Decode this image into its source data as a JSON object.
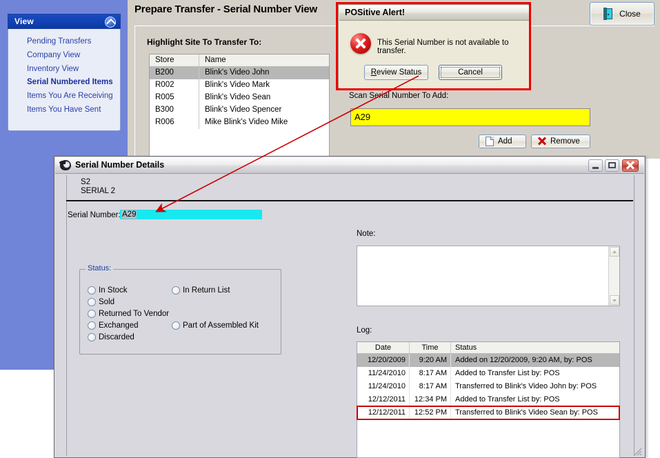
{
  "app": {
    "title": "Prepare Transfer - Serial Number View",
    "close_label": "Close"
  },
  "sidebar": {
    "header": "View",
    "collapse_icon": "chevrons-up-icon",
    "items": [
      {
        "label": "Pending Transfers",
        "active": false
      },
      {
        "label": "Company View",
        "active": false
      },
      {
        "label": "Inventory View",
        "active": false
      },
      {
        "label": "Serial Numbered Items",
        "active": true
      },
      {
        "label": "Items You Are Receiving",
        "active": false
      },
      {
        "label": "Items You Have Sent",
        "active": false
      }
    ]
  },
  "transfer": {
    "highlight_label": "Highlight Site To Transfer To:",
    "store_columns": [
      "Store",
      "Name"
    ],
    "stores": [
      {
        "store": "B200",
        "name": "Blink's Video John",
        "selected": true
      },
      {
        "store": "R002",
        "name": "Blink's Video Mark",
        "selected": false
      },
      {
        "store": "R005",
        "name": "Blink's Video Sean",
        "selected": false
      },
      {
        "store": "B300",
        "name": "Blink's Video Spencer",
        "selected": false
      },
      {
        "store": "R006",
        "name": "Mike Blink's Video Mike",
        "selected": false
      }
    ],
    "scan_label": "Scan Serial Number To Add:",
    "scan_value": "A29",
    "add_label": "Add",
    "remove_label": "Remove"
  },
  "alert": {
    "title": "POSitive Alert!",
    "icon": "error-icon",
    "message": "This Serial Number is not available to transfer.",
    "review_label_accel": "R",
    "review_label_rest": "eview Status",
    "cancel_label": "Cancel"
  },
  "details": {
    "window_title": "Serial Number Details",
    "minimize_icon": "minimize-icon",
    "maximize_icon": "maximize-icon",
    "close_icon": "close-icon",
    "item_code": "S2",
    "item_name": "SERIAL 2",
    "serial_label": "Serial Number:",
    "serial_value": "A29",
    "status": {
      "legend": "Status:",
      "left_options": [
        "In Stock",
        "Sold",
        "Returned To Vendor",
        "Exchanged",
        "Discarded"
      ],
      "right_options": [
        "In Return List",
        "Part of Assembled Kit"
      ]
    },
    "note_label": "Note:",
    "note_value": "",
    "log_label": "Log:",
    "log_columns": [
      "Date",
      "Time",
      "Status"
    ],
    "log_rows": [
      {
        "date": "12/20/2009",
        "time": "9:20 AM",
        "status": "Added on 12/20/2009,  9:20 AM, by: POS",
        "selected": true,
        "highlight": false
      },
      {
        "date": "11/24/2010",
        "time": "8:17 AM",
        "status": "Added to Transfer List by: POS",
        "selected": false,
        "highlight": false
      },
      {
        "date": "11/24/2010",
        "time": "8:17 AM",
        "status": "Transferred to Blink's Video John by: POS",
        "selected": false,
        "highlight": false
      },
      {
        "date": "12/12/2011",
        "time": "12:34 PM",
        "status": "Added to Transfer List by: POS",
        "selected": false,
        "highlight": false
      },
      {
        "date": "12/12/2011",
        "time": "12:52 PM",
        "status": "Transferred to Blink's Video Sean by: POS",
        "selected": false,
        "highlight": true
      }
    ]
  },
  "annotations": {
    "accent_red": "#cc0000",
    "highlight_yellow": "#ffff00",
    "serial_cyan": "#18e8f0"
  }
}
